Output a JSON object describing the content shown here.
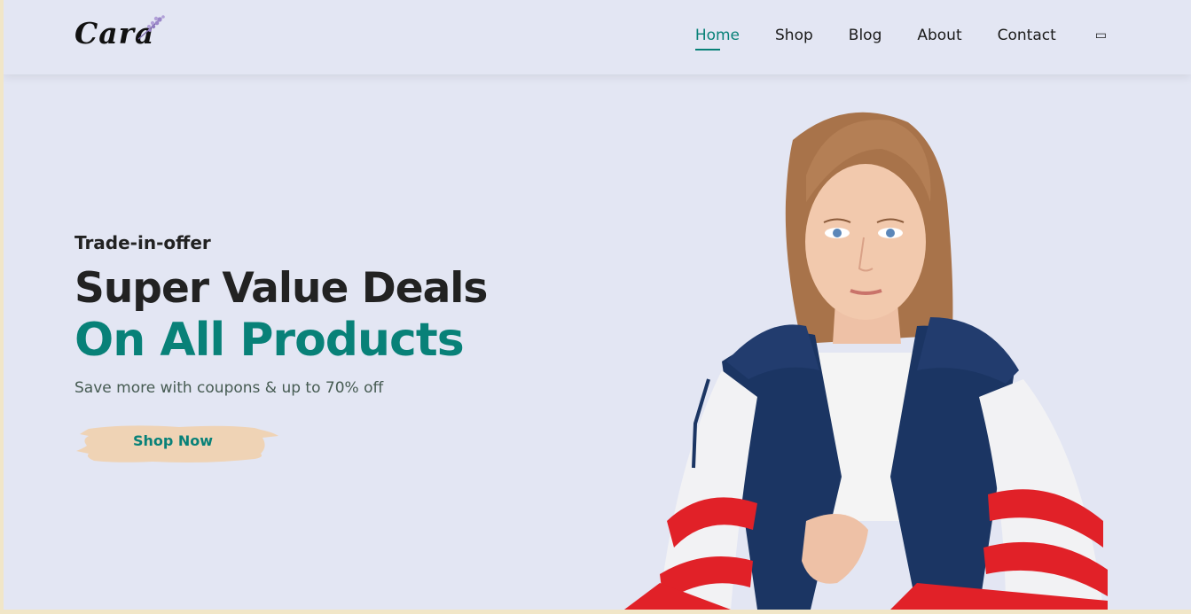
{
  "header": {
    "logo_text": "Cara",
    "nav": [
      {
        "label": "Home",
        "active": true
      },
      {
        "label": "Shop",
        "active": false
      },
      {
        "label": "Blog",
        "active": false
      },
      {
        "label": "About",
        "active": false
      },
      {
        "label": "Contact",
        "active": false
      }
    ],
    "cart_icon": "shopping-bag-icon"
  },
  "hero": {
    "tag": "Trade-in-offer",
    "heading_line1": "Super Value Deals",
    "heading_line2": "On All Products",
    "subtitle": "Save more with coupons & up to 70% off",
    "button_label": "Shop Now"
  },
  "colors": {
    "accent": "#088178",
    "background": "#e3e6f3",
    "button_bg": "#efd3b5",
    "text": "#222222"
  }
}
